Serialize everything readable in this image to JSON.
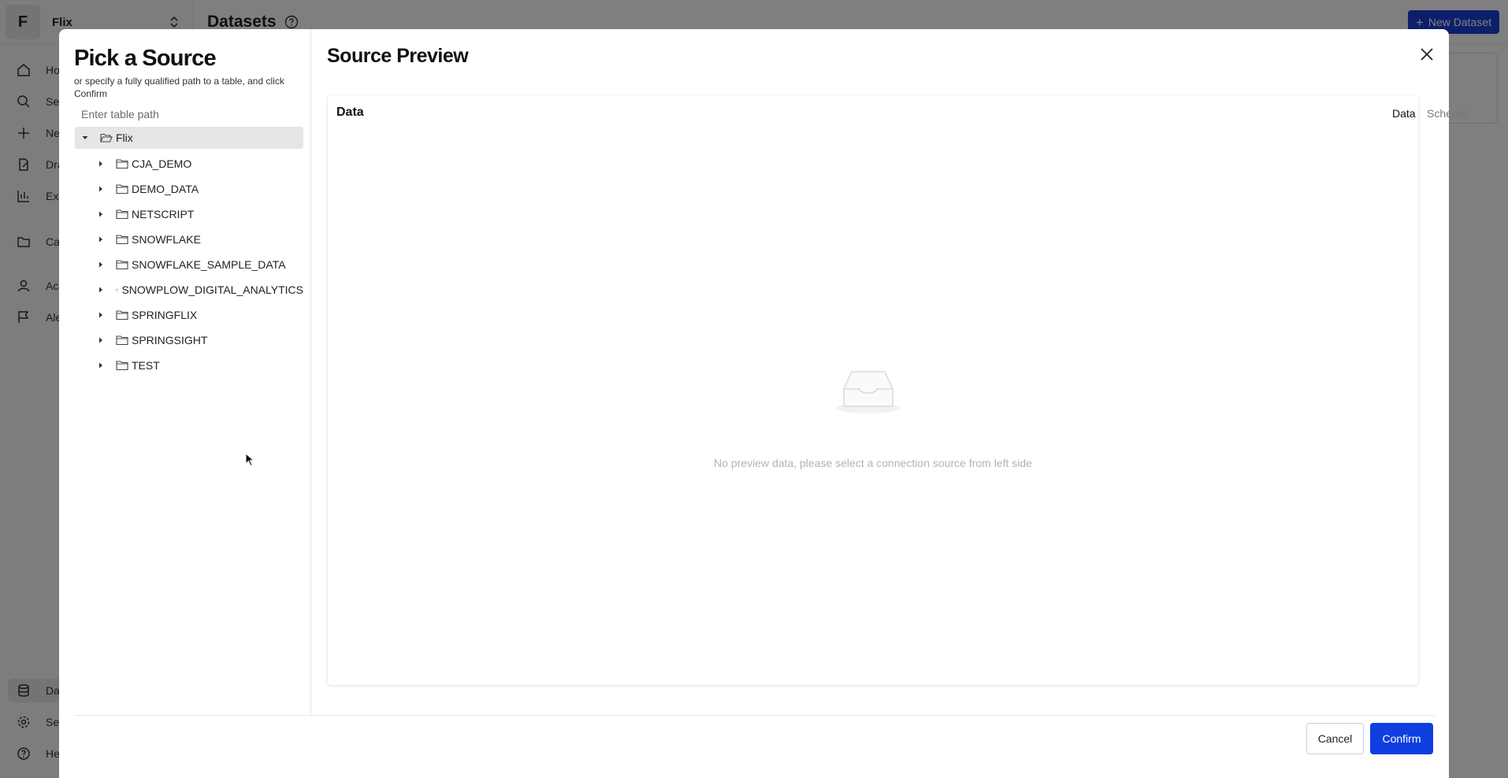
{
  "workspace": {
    "initial": "F",
    "name": "Flix"
  },
  "sidebar": {
    "items": [
      {
        "label": "Home",
        "icon": "home-icon"
      },
      {
        "label": "Search",
        "icon": "search-icon"
      },
      {
        "label": "New",
        "icon": "plus-icon"
      },
      {
        "label": "Drafts",
        "icon": "drafts-icon"
      },
      {
        "label": "Explore",
        "icon": "explore-icon"
      },
      {
        "label": "Catalog",
        "icon": "folder-icon"
      },
      {
        "label": "Accounts",
        "icon": "user-icon"
      },
      {
        "label": "Alerts",
        "icon": "flag-icon"
      },
      {
        "label": "Datasets",
        "icon": "database-icon"
      },
      {
        "label": "Settings",
        "icon": "gear-icon"
      },
      {
        "label": "Help",
        "icon": "help-icon"
      }
    ]
  },
  "header": {
    "title": "Datasets",
    "new_button": "New Dataset"
  },
  "modal": {
    "left_title": "Pick a Source",
    "left_subtitle": "or specify a fully qualified path to a table, and click Confirm",
    "path_placeholder": "Enter table path",
    "tree": {
      "root": "Flix",
      "children": [
        "CJA_DEMO",
        "DEMO_DATA",
        "NETSCRIPT",
        "SNOWFLAKE",
        "SNOWFLAKE_SAMPLE_DATA",
        "SNOWPLOW_DIGITAL_ANALYTICS",
        "SPRINGFLIX",
        "SPRINGSIGHT",
        "TEST"
      ]
    },
    "right_title": "Source Preview",
    "preview": {
      "heading": "Data",
      "tabs": [
        "Data",
        "Schema"
      ],
      "empty_text": "No preview data, please select a connection source from left side"
    },
    "cancel_label": "Cancel",
    "confirm_label": "Confirm"
  },
  "colors": {
    "primary": "#0f3fe0",
    "overlay": "rgba(0,0,0,0.5)"
  }
}
